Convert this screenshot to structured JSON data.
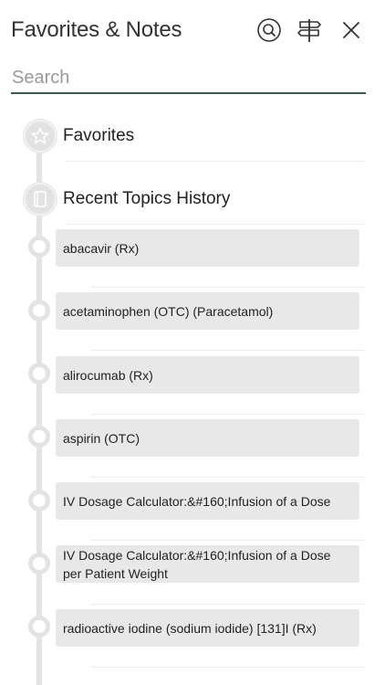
{
  "header": {
    "title": "Favorites & Notes",
    "search_button": "search-icon",
    "signpost_button": "signpost-icon",
    "close_button": "close-icon"
  },
  "search": {
    "placeholder": "Search",
    "value": ""
  },
  "sections": {
    "favorites": {
      "label": "Favorites",
      "icon": "star-icon"
    },
    "recent": {
      "label": "Recent Topics History",
      "icon": "book-icon"
    }
  },
  "recent_topics": [
    {
      "label": "abacavir (Rx)"
    },
    {
      "label": "acetaminophen (OTC) (Paracetamol)"
    },
    {
      "label": "alirocumab (Rx)"
    },
    {
      "label": "aspirin (OTC)"
    },
    {
      "label": "IV Dosage Calculator:&#160;Infusion of a Dose"
    },
    {
      "label": "IV Dosage Calculator:&#160;Infusion of a Dose per Patient Weight"
    },
    {
      "label": "radioactive iodine (sodium iodide) [131]I (Rx)"
    }
  ],
  "colors": {
    "accent_underline": "#3a5a4e",
    "card_background": "#e8e8e8",
    "timeline": "#e3e3e3"
  }
}
